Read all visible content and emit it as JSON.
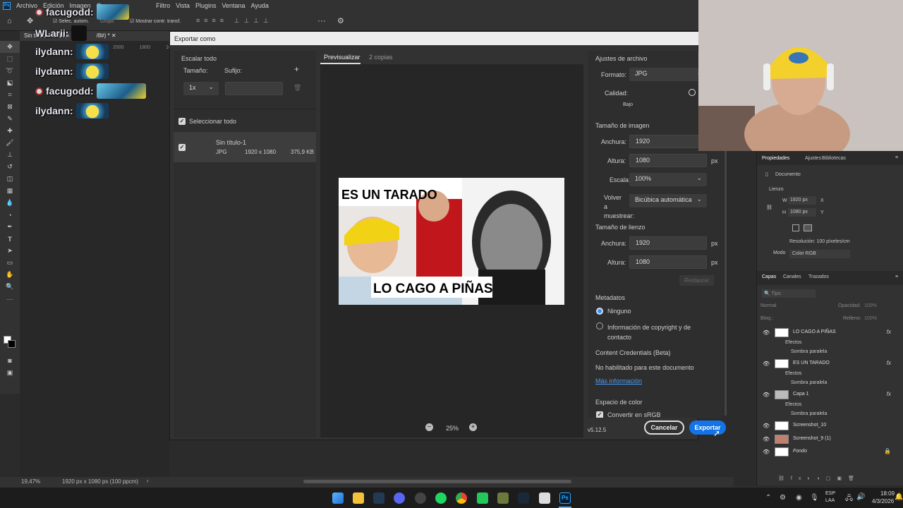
{
  "menubar": {
    "items": [
      "Archivo",
      "Edición",
      "Imagen",
      "Cap",
      "Filtro",
      "Vista",
      "Plugins",
      "Ventana",
      "Ayuda"
    ]
  },
  "optionsbar": {
    "auto_select": "Selec. autom.",
    "group": "Grupo",
    "show_transform": "Mostrar contr. transf."
  },
  "document_tab": {
    "title": "Sin título-1 al 19,5",
    "tail": "/8#) *"
  },
  "ruler": {
    "marks": [
      "2000",
      "1800",
      "1600"
    ]
  },
  "status": {
    "zoom": "19,47%",
    "info": "1920 px x 1080 px (100 ppcm)"
  },
  "chat": [
    {
      "user": "facugodd:",
      "emote": "fish-emote"
    },
    {
      "user": "WLarii:",
      "emote": "face-emote"
    },
    {
      "user": "ilydann:",
      "emote": "minion-emote"
    },
    {
      "user": "ilydann:",
      "emote": "minion-emote"
    },
    {
      "user": "facugodd:",
      "emote": "fish-emote"
    },
    {
      "user": "ilydann:",
      "emote": "minion-emote"
    }
  ],
  "dialog": {
    "title": "Exportar como",
    "scale_all": "Escalar todo",
    "size_label": "Tamaño:",
    "suffix_label": "Sufijo:",
    "scale_value": "1x",
    "suffix_value": "",
    "select_all": "Seleccionar todo",
    "asset": {
      "name": "Sin título-1",
      "format": "JPG",
      "dims": "1920 x 1080",
      "size": "375,9 KB"
    },
    "tabs": [
      "Previsualizar",
      "2 copias"
    ],
    "zoom": "25%",
    "preview_texts": [
      "ES UN TARADO",
      "LO CAGO A PIÑAS"
    ],
    "file_settings": {
      "heading": "Ajustes de archivo",
      "format_label": "Formato:",
      "format_value": "JPG",
      "quality_label": "Calidad:",
      "quality_caption": "Bajo"
    },
    "image_size": {
      "heading": "Tamaño de imagen",
      "width_label": "Anchura:",
      "width_value": "1920",
      "height_label": "Altura:",
      "height_value": "1080",
      "unit": "px",
      "scale_label": "Escala:",
      "scale_value": "100%",
      "resample_label": "Volver a muestrear:",
      "resample_value": "Bicúbica automática"
    },
    "canvas_size": {
      "heading": "Tamaño de lienzo",
      "width_label": "Anchura:",
      "width_value": "1920",
      "height_label": "Altura:",
      "height_value": "1080",
      "unit": "px",
      "restore": "Restaurar"
    },
    "metadata": {
      "heading": "Metadatos",
      "opt_none": "Ninguno",
      "opt_copyright": "Información de copyright y de contacto"
    },
    "content_credentials": {
      "heading": "Content Credentials (Beta)",
      "text": "No habilitado para este documento",
      "link": "Más información"
    },
    "color_space": {
      "heading": "Espacio de color",
      "convert": "Convertir en sRGB"
    },
    "version": "v5.12.5",
    "cancel": "Cancelar",
    "export": "Exportar"
  },
  "properties": {
    "tabs": [
      "Propiedades",
      "Ajustes",
      "Bibliotecas"
    ],
    "doc": "Documento",
    "canvas": "Lienzo",
    "w": "1920 px",
    "h": "1080 px",
    "x": "X",
    "y": "Y",
    "resolution": "Resolución: 100 píxeles/cm",
    "mode_label": "Modo",
    "mode_value": "Color RGB"
  },
  "layers": {
    "tabs": [
      "Capas",
      "Canales",
      "Trazados"
    ],
    "kind": "Tipo",
    "blend": "Normal",
    "opacity": "Opacidad:",
    "opacity_value": "100%",
    "lock": "Bloq.:",
    "fill": "Relleno:",
    "fill_value": "100%",
    "effects": "Efectos",
    "shadow": "Sombra paralela",
    "items": [
      {
        "name": "LO CAGO A PIÑAS",
        "fx": "fx"
      },
      {
        "name": "ES UN TARADO",
        "fx": "fx"
      },
      {
        "name": "Capa 1",
        "fx": "fx"
      },
      {
        "name": "Screenshot_10",
        "fx": ""
      },
      {
        "name": "Screenshot_9 (1)",
        "fx": ""
      },
      {
        "name": "Fondo",
        "fx": ""
      }
    ]
  },
  "taskbar": {
    "lang": "ESP",
    "lang2": "LAA",
    "time": "18:09",
    "date": "4/3/2026"
  },
  "colors": {
    "accent": "#1473e6",
    "dialog_bg": "#323232",
    "preview_bg": "#262626"
  }
}
